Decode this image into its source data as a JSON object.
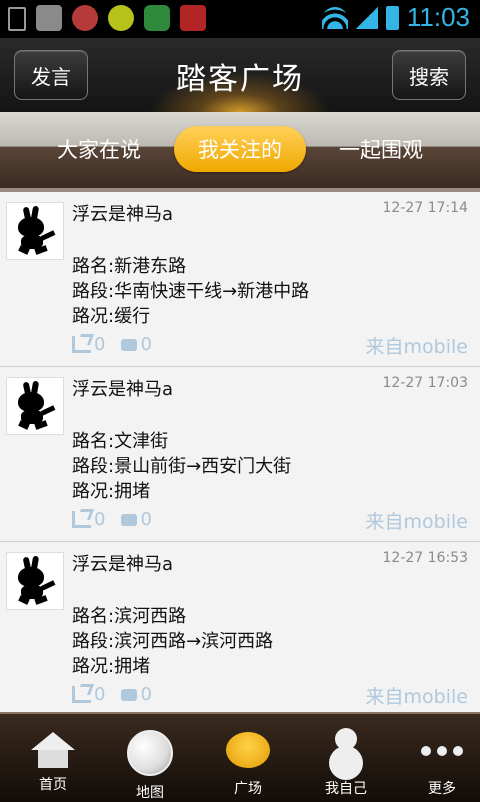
{
  "status_bar": {
    "time": "11:03",
    "icons": [
      "usb-icon",
      "android-icon",
      "alarm-icon",
      "plus-app-icon",
      "shield-icon",
      "easy-app-icon",
      "wifi-icon",
      "signal-icon",
      "battery-icon"
    ]
  },
  "header": {
    "left_button": "发言",
    "title": "踏客广场",
    "right_button": "搜索"
  },
  "tabs": [
    {
      "label": "大家在说",
      "active": false
    },
    {
      "label": "我关注的",
      "active": true
    },
    {
      "label": "一起围观",
      "active": false
    }
  ],
  "posts": [
    {
      "user": "浮云是神马a",
      "time": "12-27 17:14",
      "road_name": "路名:新港东路",
      "road_section": "路段:华南快速干线→新港中路",
      "condition": "路况:缓行",
      "shares": "0",
      "comments": "0",
      "source": "来自mobile"
    },
    {
      "user": "浮云是神马a",
      "time": "12-27 17:03",
      "road_name": "路名:文津街",
      "road_section": "路段:景山前街→西安门大街",
      "condition": "路况:拥堵",
      "shares": "0",
      "comments": "0",
      "source": "来自mobile"
    },
    {
      "user": "浮云是神马a",
      "time": "12-27 16:53",
      "road_name": "路名:滨河西路",
      "road_section": "路段:滨河西路→滨河西路",
      "condition": "路况:拥堵",
      "shares": "0",
      "comments": "0",
      "source": "来自mobile"
    }
  ],
  "bottom_nav": [
    {
      "label": "首页",
      "icon": "home-icon"
    },
    {
      "label": "地图",
      "icon": "globe-icon"
    },
    {
      "label": "广场",
      "icon": "chat-bubble-icon"
    },
    {
      "label": "我自己",
      "icon": "person-icon"
    },
    {
      "label": "更多",
      "icon": "more-icon"
    }
  ],
  "colors": {
    "accent_orange": "#f0a800",
    "status_blue": "#33b5e5",
    "meta_blue": "#b0c8dc"
  }
}
